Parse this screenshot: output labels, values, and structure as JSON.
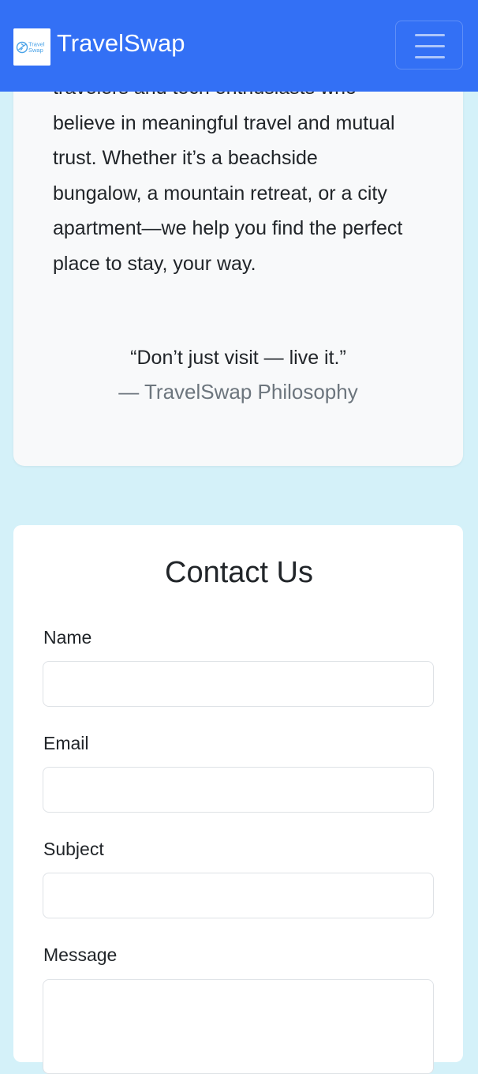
{
  "navbar": {
    "brand_name": "TravelSwap",
    "logo_text_line1": "Travel",
    "logo_text_line2": "Swap",
    "menu_icon": "hamburger-menu-icon",
    "background_color": "#3370f5"
  },
  "about": {
    "partial_first_line": "travelers and tech enthusiasts who",
    "lines": [
      "believe in meaningful travel and mutual",
      "trust. Whether it’s a beachside",
      "bungalow, a mountain retreat, or a city",
      "apartment—we help you find the perfect",
      "place to stay, your way."
    ],
    "quote": "“Don’t just visit — live it.”",
    "quote_author": "— TravelSwap Philosophy"
  },
  "contact": {
    "title": "Contact Us",
    "fields": [
      {
        "label": "Name",
        "value": ""
      },
      {
        "label": "Email",
        "value": ""
      },
      {
        "label": "Subject",
        "value": ""
      },
      {
        "label": "Message",
        "value": ""
      }
    ]
  },
  "colors": {
    "page_background": "#d4f1f9",
    "card_background": "#f8f9fa",
    "muted_text": "#6c757d"
  }
}
